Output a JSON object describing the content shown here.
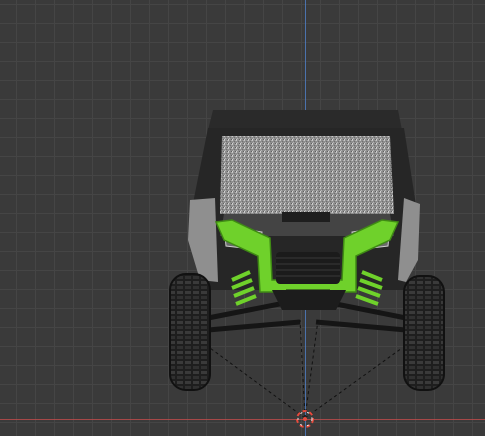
{
  "viewport": {
    "grid_color": "#454545",
    "background_color": "#3a3a3a",
    "axis_z_color": "#4f7dc1",
    "axis_x_color": "#b34a4a"
  },
  "model": {
    "icon": "utv-vehicle-front-icon",
    "accent_color": "#6fd12b",
    "body_color": "#2b2b2b",
    "glass_color": "#9a9a9a"
  },
  "origin_marker": {
    "icon": "origin-cursor-icon",
    "color": "#e64a3c"
  }
}
